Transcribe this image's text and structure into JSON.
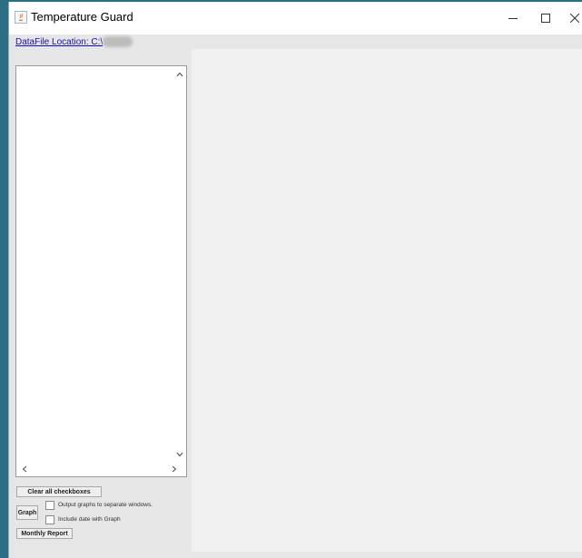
{
  "window": {
    "title": "Temperature Guard",
    "controls": {
      "minimize_icon": "minimize-icon",
      "maximize_icon": "maximize-icon",
      "close_icon": "close-icon"
    }
  },
  "location": {
    "link_text": "DataFile Location: C:\\"
  },
  "left_panel": {
    "list_items": [],
    "clear_button_label": "Clear all checkboxes",
    "graph_button_label": "Graph",
    "options": [
      {
        "label": "Output graphs to separate windows.",
        "checked": false
      },
      {
        "label": "Include date with Graph",
        "checked": false
      }
    ],
    "monthly_report_label": "Monthly Report"
  },
  "colors": {
    "link": "#1a0dab",
    "content_background": "#f0f0f0",
    "panel_background": "#e6e6e6"
  }
}
